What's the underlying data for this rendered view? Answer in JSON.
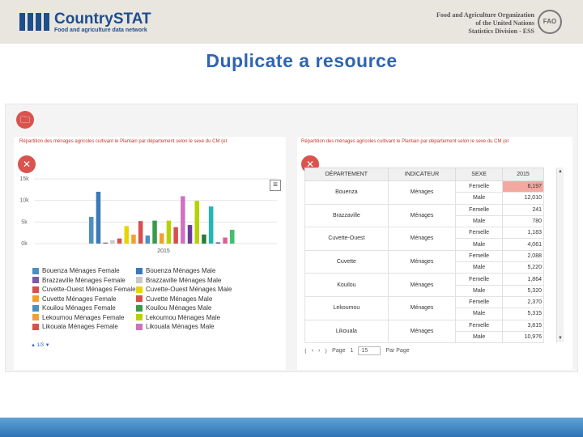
{
  "header": {
    "brand": "CountrySTAT",
    "tagline": "Food and agriculture data network",
    "org_lines": [
      "Food and Agriculture Organization",
      "of the United Nations",
      "Statistics Division - ESS"
    ],
    "emblem": "FAO"
  },
  "title": "Duplicate a resource",
  "left_panel": {
    "heading": "Répartition des ménages agricoles cultivant le Plantain par département selon le sexe du CM (et",
    "icons": [
      "folder-icon",
      "tools-icon",
      "menu-icon"
    ],
    "menu_glyph": "≡",
    "legend_nav": "▲ 1/3 ▼"
  },
  "right_panel": {
    "heading": "Répartition des ménages agricoles cultivant le Plantain par département selon le sexe du CM (et",
    "icons": [
      "tools-icon"
    ],
    "columns": [
      "DÉPARTEMENT",
      "INDICATEUR",
      "SEXE",
      "2015"
    ],
    "groups": [
      {
        "dept": "Bouenza",
        "ind": "Ménages",
        "rows": [
          {
            "sexe": "Femelle",
            "val": "6,197",
            "hl": true
          },
          {
            "sexe": "Male",
            "val": "12,010"
          }
        ]
      },
      {
        "dept": "Brazzaville",
        "ind": "Ménages",
        "rows": [
          {
            "sexe": "Femelle",
            "val": "241"
          },
          {
            "sexe": "Male",
            "val": "780"
          }
        ]
      },
      {
        "dept": "Cuvette-Ouest",
        "ind": "Ménages",
        "rows": [
          {
            "sexe": "Femelle",
            "val": "1,183"
          },
          {
            "sexe": "Male",
            "val": "4,061"
          }
        ]
      },
      {
        "dept": "Cuvette",
        "ind": "Ménages",
        "rows": [
          {
            "sexe": "Femelle",
            "val": "2,088"
          },
          {
            "sexe": "Male",
            "val": "5,220"
          }
        ]
      },
      {
        "dept": "Kouilou",
        "ind": "Ménages",
        "rows": [
          {
            "sexe": "Femelle",
            "val": "1,864"
          },
          {
            "sexe": "Male",
            "val": "5,320"
          }
        ]
      },
      {
        "dept": "Lekoumou",
        "ind": "Ménages",
        "rows": [
          {
            "sexe": "Femelle",
            "val": "2,370"
          },
          {
            "sexe": "Male",
            "val": "5,315"
          }
        ]
      },
      {
        "dept": "Likouala",
        "ind": "Ménages",
        "rows": [
          {
            "sexe": "Femelle",
            "val": "3,815"
          },
          {
            "sexe": "Male",
            "val": "10,976"
          }
        ]
      }
    ],
    "pager": {
      "page_label": "Page",
      "page_value": "1",
      "per_page": "15",
      "per_page_label": "Par Page",
      "first": "⟨",
      "prev": "‹",
      "next": "›",
      "last": "⟩"
    }
  },
  "chart_data": {
    "type": "bar",
    "categories": [
      "2015"
    ],
    "yticks": [
      "15k",
      "10k",
      "5k",
      "0k"
    ],
    "ylim": [
      0,
      15000
    ],
    "series": [
      {
        "name": "Bouenza Ménages Female",
        "color": "#4f8fc0",
        "values": [
          6197
        ]
      },
      {
        "name": "Bouenza Ménages Male",
        "color": "#3a7ab8",
        "values": [
          12010
        ]
      },
      {
        "name": "Brazzaville Ménages Female",
        "color": "#7b5aa6",
        "values": [
          241
        ]
      },
      {
        "name": "Brazzaville Ménages Male",
        "color": "#c8c8c8",
        "values": [
          780
        ]
      },
      {
        "name": "Cuvette-Ouest Ménages Female",
        "color": "#d94f4f",
        "values": [
          1183
        ]
      },
      {
        "name": "Cuvette-Ouest Ménages Male",
        "color": "#e6d600",
        "values": [
          4061
        ]
      },
      {
        "name": "Cuvette Ménages Female",
        "color": "#f0a030",
        "values": [
          2088
        ]
      },
      {
        "name": "Cuvette Ménages Male",
        "color": "#d94f4f",
        "values": [
          5220
        ]
      },
      {
        "name": "Kouilou Ménages Female",
        "color": "#4f8fc0",
        "values": [
          1864
        ]
      },
      {
        "name": "Kouilou Ménages Male",
        "color": "#3a9a4a",
        "values": [
          5320
        ]
      },
      {
        "name": "Lekoumou Ménages Female",
        "color": "#f0a030",
        "values": [
          2370
        ]
      },
      {
        "name": "Lekoumou Ménages Male",
        "color": "#b9d000",
        "values": [
          5315
        ]
      },
      {
        "name": "Likouala Ménages Female",
        "color": "#d94f4f",
        "values": [
          3815
        ]
      },
      {
        "name": "Likouala Ménages Male",
        "color": "#d070c0",
        "values": [
          10976
        ]
      },
      {
        "name": "",
        "color": "#6a3d9a",
        "values": [
          4300
        ]
      },
      {
        "name": "",
        "color": "#b9d000",
        "values": [
          9900
        ]
      },
      {
        "name": "",
        "color": "#2a7a3a",
        "values": [
          2100
        ]
      },
      {
        "name": "",
        "color": "#20b8b0",
        "values": [
          8600
        ]
      },
      {
        "name": "",
        "color": "#5060c0",
        "values": [
          300
        ]
      },
      {
        "name": "",
        "color": "#e06090",
        "values": [
          1400
        ]
      },
      {
        "name": "",
        "color": "#40c070",
        "values": [
          3200
        ]
      }
    ]
  }
}
